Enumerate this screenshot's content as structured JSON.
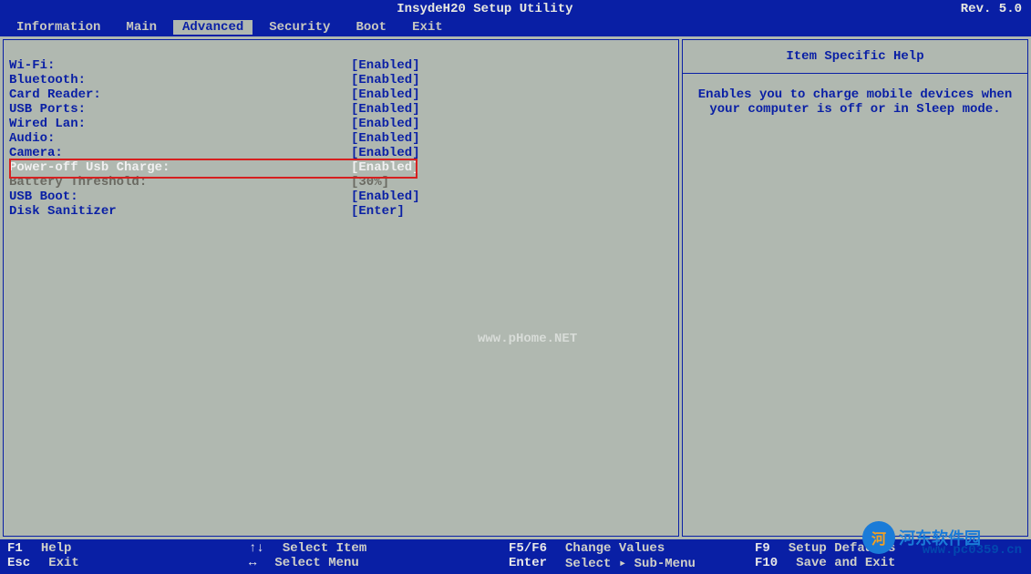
{
  "title": {
    "center": "InsydeH20 Setup Utility",
    "right": "Rev. 5.0"
  },
  "menu": {
    "items": [
      {
        "label": "Information",
        "name": "menu-information"
      },
      {
        "label": "Main",
        "name": "menu-main"
      },
      {
        "label": "Advanced",
        "name": "menu-advanced"
      },
      {
        "label": "Security",
        "name": "menu-security"
      },
      {
        "label": "Boot",
        "name": "menu-boot"
      },
      {
        "label": "Exit",
        "name": "menu-exit"
      }
    ],
    "active_index": 2
  },
  "settings": [
    {
      "label": "Wi-Fi:",
      "value": "[Enabled]",
      "highlighted": false
    },
    {
      "label": "Bluetooth:",
      "value": "[Enabled]",
      "highlighted": false
    },
    {
      "label": "Card Reader:",
      "value": "[Enabled]",
      "highlighted": false
    },
    {
      "label": "USB Ports:",
      "value": "[Enabled]",
      "highlighted": false
    },
    {
      "label": "Wired Lan:",
      "value": "[Enabled]",
      "highlighted": false
    },
    {
      "label": "Audio:",
      "value": "[Enabled]",
      "highlighted": false
    },
    {
      "label": "Camera:",
      "value": "[Enabled]",
      "highlighted": false
    },
    {
      "label": "Power-off Usb Charge:",
      "value": "[Enabled]",
      "highlighted": true
    },
    {
      "label": "Battery Threshold:",
      "value": "[30%]",
      "highlighted": false,
      "after": true
    },
    {
      "label": "USB Boot:",
      "value": "[Enabled]",
      "highlighted": false
    },
    {
      "label": "Disk Sanitizer",
      "value": "[Enter]",
      "highlighted": false
    }
  ],
  "help": {
    "header": "Item Specific Help",
    "content": "Enables you to charge mobile devices when your computer is off or in Sleep mode."
  },
  "footer": {
    "row1": [
      {
        "key": "F1",
        "label": "Help"
      },
      {
        "key": "↑↓",
        "label": "Select Item"
      },
      {
        "key": "F5/F6",
        "label": "Change Values"
      },
      {
        "key": "F9",
        "label": "Setup Defaults"
      }
    ],
    "row2": [
      {
        "key": "Esc",
        "label": "Exit"
      },
      {
        "key": "↔",
        "label": "Select Menu"
      },
      {
        "key": "Enter",
        "label": "Select ▸ Sub-Menu"
      },
      {
        "key": "F10",
        "label": "Save and Exit"
      }
    ]
  },
  "watermarks": {
    "w1": "www.pHome.NET",
    "w2": "www.pc0359.cn",
    "w3": "河东软件园"
  }
}
